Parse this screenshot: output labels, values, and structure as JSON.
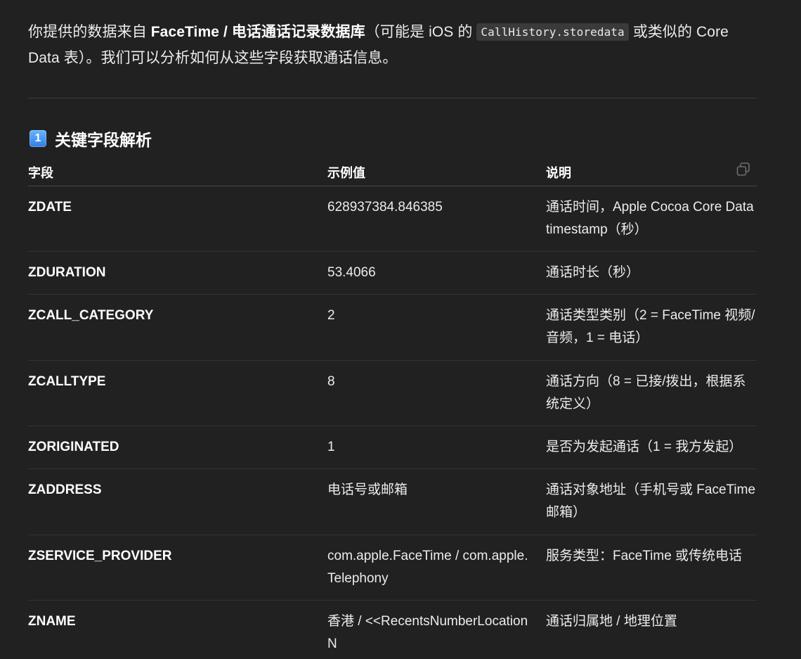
{
  "intro": {
    "part1": "你提供的数据来自 ",
    "bold": "FaceTime / 电话通话记录数据库",
    "part2": "（可能是 iOS 的 ",
    "code": "CallHistory.storedata",
    "part3": " 或类似的 Core Data 表）。我们可以分析如何从这些字段获取通话信息。"
  },
  "section": {
    "number": "1",
    "title": "关键字段解析"
  },
  "table": {
    "headers": [
      "字段",
      "示例值",
      "说明"
    ],
    "rows": [
      {
        "field": "ZDATE",
        "example": "628937384.846385",
        "desc": "通话时间，Apple Cocoa Core Data timestamp（秒）"
      },
      {
        "field": "ZDURATION",
        "example": "53.4066",
        "desc": "通话时长（秒）"
      },
      {
        "field": "ZCALL_CATEGORY",
        "example": "2",
        "desc": "通话类型类别（2 = FaceTime 视频/音频，1 = 电话）"
      },
      {
        "field": "ZCALLTYPE",
        "example": "8",
        "desc": "通话方向（8 = 已接/拨出，根据系统定义）"
      },
      {
        "field": "ZORIGINATED",
        "example": "1",
        "desc": "是否为发起通话（1 = 我方发起）"
      },
      {
        "field": "ZADDRESS",
        "example": "电话号或邮箱",
        "desc": "通话对象地址（手机号或 FaceTime 邮箱）"
      },
      {
        "field": "ZSERVICE_PROVIDER",
        "example": "com.apple.FaceTime / com.apple.Telephony",
        "desc": "服务类型：FaceTime 或传统电话"
      },
      {
        "field": "ZNAME",
        "example": "香港 / <<RecentsNumberLocationN",
        "desc": "通话归属地 / 地理位置"
      }
    ]
  }
}
